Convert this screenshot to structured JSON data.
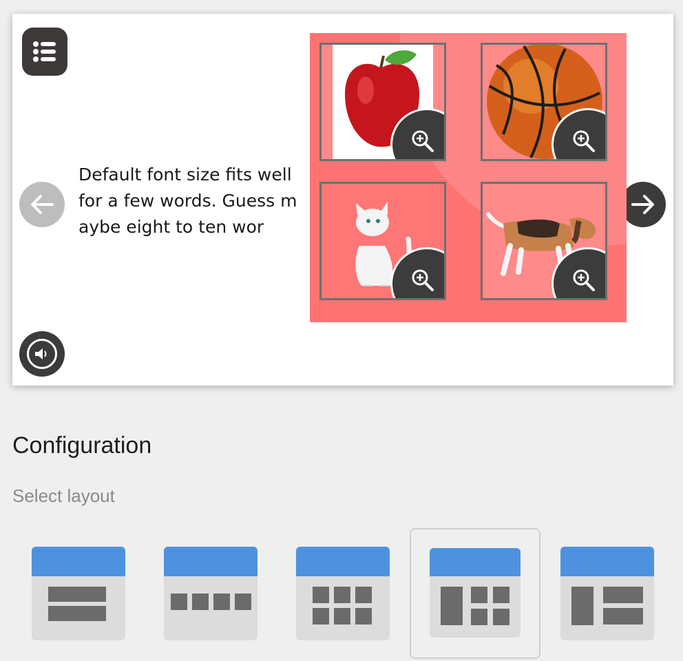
{
  "prompt": {
    "text": "Default font size fits well for a few words. Guess maybe eight to ten wor"
  },
  "controls": {
    "menu_icon": "list-icon",
    "prev_icon": "arrow-left-icon",
    "next_icon": "arrow-right-icon",
    "audio_icon": "speaker-replay-icon"
  },
  "grid": {
    "background": "#ff7373",
    "items": [
      {
        "name": "apple",
        "icon": "zoom-in-icon"
      },
      {
        "name": "basketball",
        "icon": "zoom-in-icon"
      },
      {
        "name": "cat",
        "icon": "zoom-in-icon"
      },
      {
        "name": "dog",
        "icon": "zoom-in-icon"
      }
    ]
  },
  "config": {
    "title": "Configuration",
    "subtitle": "Select layout",
    "layouts": [
      "two-rows",
      "four-columns",
      "two-by-three-grid",
      "side-plus-grid",
      "side-plus-rows"
    ],
    "selected_index": 3,
    "accent": "#4e92df"
  }
}
